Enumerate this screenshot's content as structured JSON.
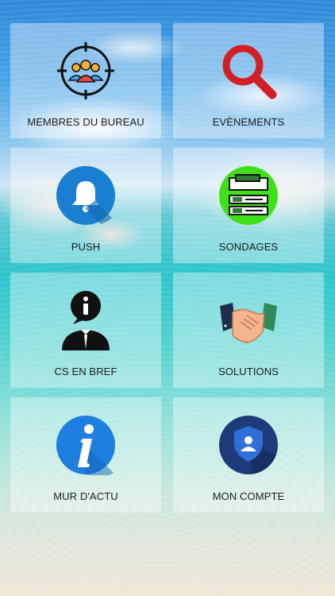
{
  "tiles": [
    {
      "label": "MEMBRES DU BUREAU",
      "icon": "team-target-icon"
    },
    {
      "label": "EVÈNEMENTS",
      "icon": "search-icon"
    },
    {
      "label": "PUSH",
      "icon": "bell-icon"
    },
    {
      "label": "SONDAGES",
      "icon": "survey-icon"
    },
    {
      "label": "CS EN BREF",
      "icon": "info-person-icon"
    },
    {
      "label": "SOLUTIONS",
      "icon": "handshake-icon"
    },
    {
      "label": "MUR D'ACTU",
      "icon": "info-icon"
    },
    {
      "label": "MON COMPTE",
      "icon": "account-shield-icon"
    }
  ],
  "colors": {
    "tile_background": "#ffffff",
    "search_red": "#d21f26",
    "push_blue": "#1a7fd0",
    "survey_green": "#3ee01a",
    "info_blue": "#1d7fe0",
    "account_navy": "#1e3a78"
  }
}
